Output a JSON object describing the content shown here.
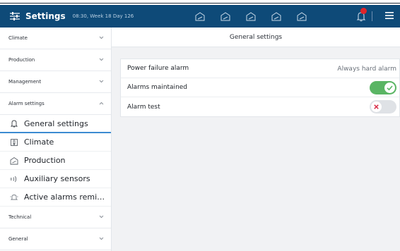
{
  "header": {
    "title": "Settings",
    "subtitle": "08:30, Week 18 Day 126",
    "icons": [
      "settings-sliders-icon",
      "house-icon",
      "house-icon",
      "house-icon",
      "house-icon",
      "house-icon",
      "bell-icon",
      "menu-icon"
    ],
    "colors": {
      "bar": "#0e4a78",
      "badge": "#e0242a"
    }
  },
  "sidebar": {
    "sections": [
      {
        "label": "Climate",
        "expanded": false
      },
      {
        "label": "Production",
        "expanded": false
      },
      {
        "label": "Management",
        "expanded": false
      },
      {
        "label": "Alarm settings",
        "expanded": true
      },
      {
        "label": "Technical",
        "expanded": false
      },
      {
        "label": "General",
        "expanded": false
      }
    ],
    "alarm_items": [
      {
        "label": "General settings",
        "icon": "bell-icon",
        "active": true
      },
      {
        "label": "Climate",
        "icon": "thermometer-icon",
        "active": false
      },
      {
        "label": "Production",
        "icon": "house-icon",
        "active": false
      },
      {
        "label": "Auxiliary sensors",
        "icon": "sensor-icon",
        "active": false
      },
      {
        "label": "Active alarms remin...",
        "icon": "reminder-icon",
        "active": false
      }
    ]
  },
  "main": {
    "title": "General settings",
    "rows": [
      {
        "label": "Power failure alarm",
        "value": "Always hard alarm"
      },
      {
        "label": "Alarms maintained",
        "toggle": true
      },
      {
        "label": "Alarm test",
        "toggle": false
      }
    ],
    "colors": {
      "toggle_on": "#5ab564",
      "toggle_off": "#dfe2e6",
      "toggle_off_mark": "#d9304a"
    }
  }
}
